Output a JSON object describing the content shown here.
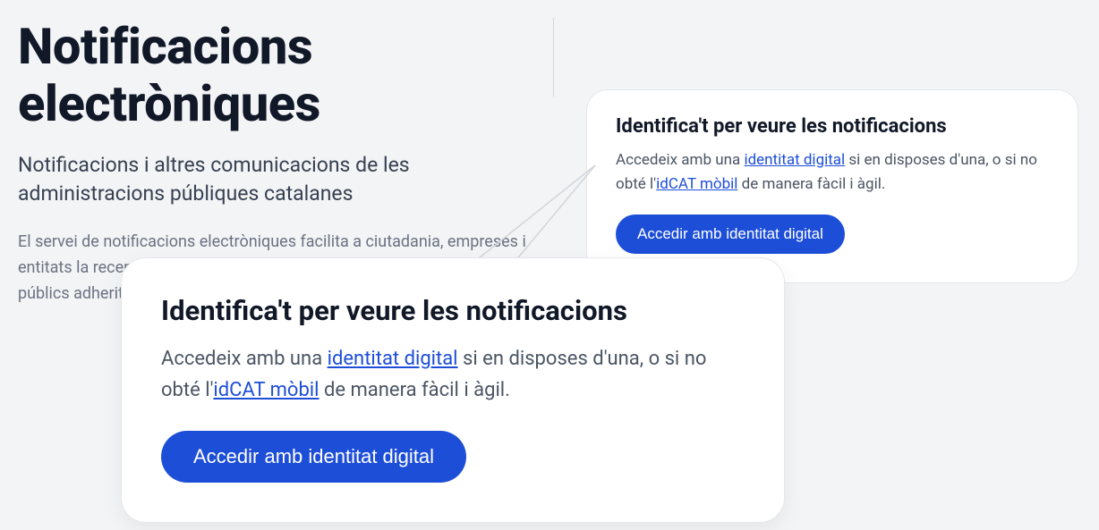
{
  "page": {
    "title": "Notificacions electròniques",
    "subtitle": "Notificacions i altres comunicacions de les administracions públiques catalanes",
    "description": "El servei de notificacions electròniques facilita a ciutadania, empreses i entitats la recepció de comunicacions i notificacions dels organismes públics adherits."
  },
  "card": {
    "title": "Identifica't per veure les notificacions",
    "desc_pre": "Accedeix amb una ",
    "link1": "identitat digital",
    "desc_mid": " si en disposes d'una, o si no obté l'",
    "link2": "idCAT mòbil",
    "desc_post": " de manera fàcil i àgil.",
    "button": "Accedir amb identitat digital"
  }
}
